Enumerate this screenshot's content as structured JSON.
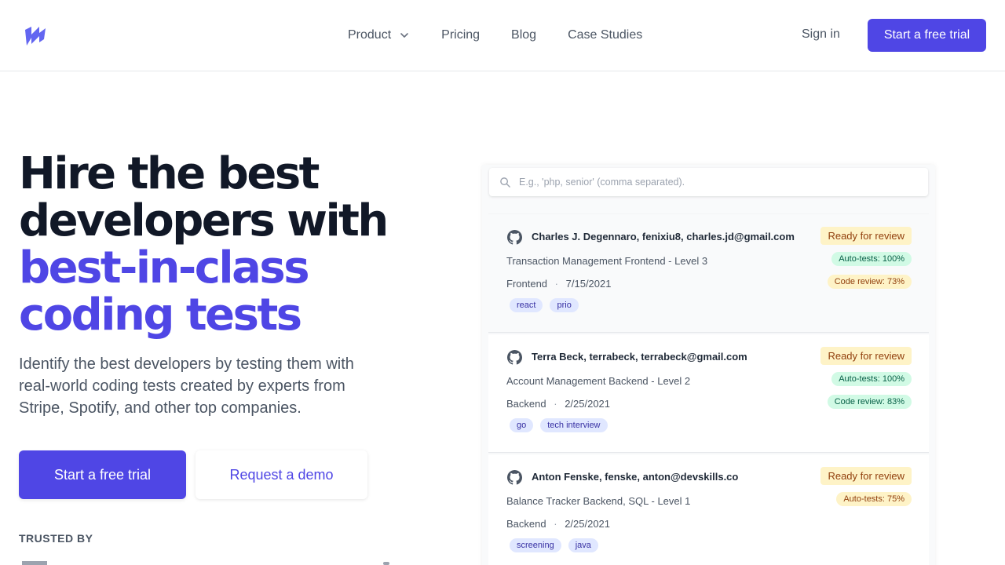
{
  "header": {
    "nav": [
      {
        "label": "Product",
        "has_dropdown": true
      },
      {
        "label": "Pricing"
      },
      {
        "label": "Blog"
      },
      {
        "label": "Case Studies"
      }
    ],
    "sign_in": "Sign in",
    "cta": "Start a free trial",
    "brand_color": "#4f46e5"
  },
  "hero": {
    "title_line1": "Hire the best",
    "title_line2": "developers with",
    "title_line3": "best-in-class",
    "title_line4": "coding tests",
    "subtitle": "Identify the best developers by testing them with real-world coding tests created by experts from Stripe, Spotify, and other top companies.",
    "primary_cta": "Start a free trial",
    "secondary_cta": "Request a demo",
    "trusted_by": "TRUSTED BY"
  },
  "panel": {
    "search_placeholder": "E.g., 'php, senior' (comma separated).",
    "candidates": [
      {
        "name": "Charles J. Degennaro, fenixiu8, charles.jd@gmail.com",
        "test": "Transaction Management Frontend - Level 3",
        "area": "Frontend",
        "date": "7/15/2021",
        "tags": [
          "react",
          "prio"
        ],
        "status": "Ready for review",
        "auto_tests": "Auto-tests: 100%",
        "code_review": "Code review: 73%"
      },
      {
        "name": "Terra Beck, terrabeck, terrabeck@gmail.com",
        "test": "Account Management Backend - Level 2",
        "area": "Backend",
        "date": "2/25/2021",
        "tags": [
          "go",
          "tech interview"
        ],
        "status": "Ready for review",
        "auto_tests": "Auto-tests: 100%",
        "code_review": "Code review: 83%"
      },
      {
        "name": "Anton Fenske, fenske, anton@devskills.co",
        "test": "Balance Tracker Backend, SQL - Level 1",
        "area": "Backend",
        "date": "2/25/2021",
        "tags": [
          "screening",
          "java"
        ],
        "status": "Ready for review",
        "auto_tests": "Auto-tests: 75%"
      }
    ]
  }
}
